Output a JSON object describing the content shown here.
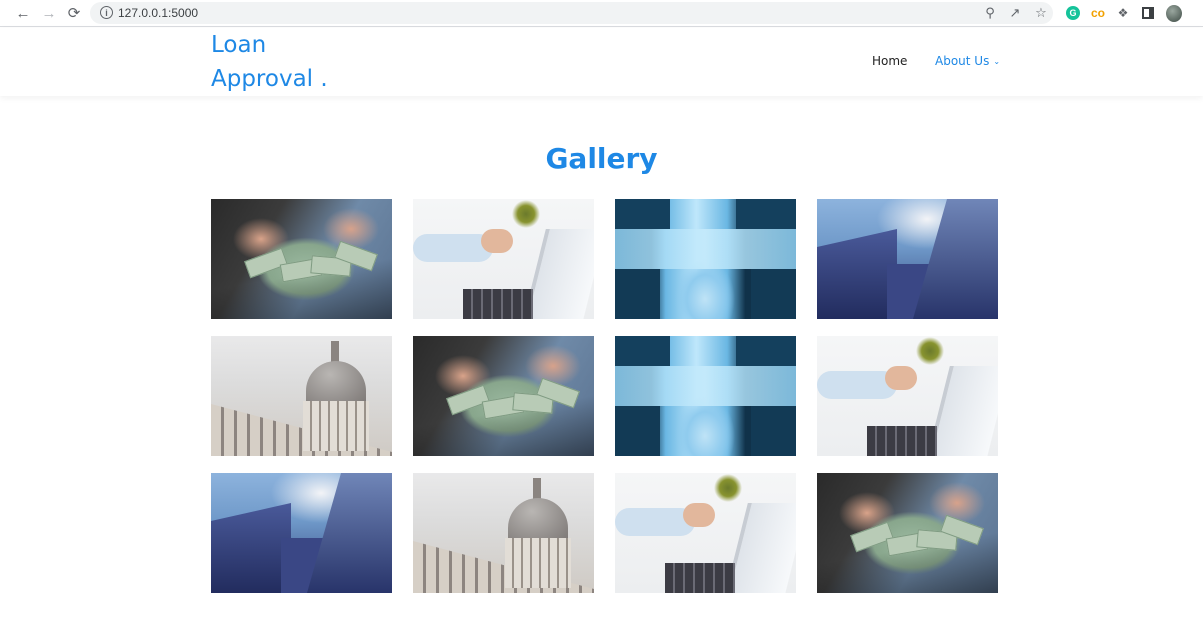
{
  "browser": {
    "url": "127.0.0.1:5000",
    "icons": [
      "back-icon",
      "forward-icon",
      "reload-icon",
      "info-icon",
      "zoom-icon",
      "share-icon",
      "bookmark-star-icon",
      "grammarly-icon",
      "extension-orange-icon",
      "puzzle-icon",
      "sidebar-icon",
      "profile-avatar"
    ]
  },
  "site": {
    "logo_line1": "Loan",
    "logo_line2": "Approval .",
    "nav": {
      "home": "Home",
      "about": "About Us"
    },
    "accent_color": "#1e88e5"
  },
  "gallery": {
    "title": "Gallery",
    "images": [
      {
        "subject": "hands holding dollar bills"
      },
      {
        "subject": "person writing at desk with laptop"
      },
      {
        "subject": "umbrella reflection in puddle"
      },
      {
        "subject": "glass skyscrapers from below"
      },
      {
        "subject": "domed classical building"
      },
      {
        "subject": "hands holding dollar bills"
      },
      {
        "subject": "umbrella reflection in puddle"
      },
      {
        "subject": "person writing at desk with laptop"
      },
      {
        "subject": "glass skyscrapers from below"
      },
      {
        "subject": "domed classical building"
      },
      {
        "subject": "person writing at desk with laptop"
      },
      {
        "subject": "hands holding dollar bills"
      }
    ]
  }
}
